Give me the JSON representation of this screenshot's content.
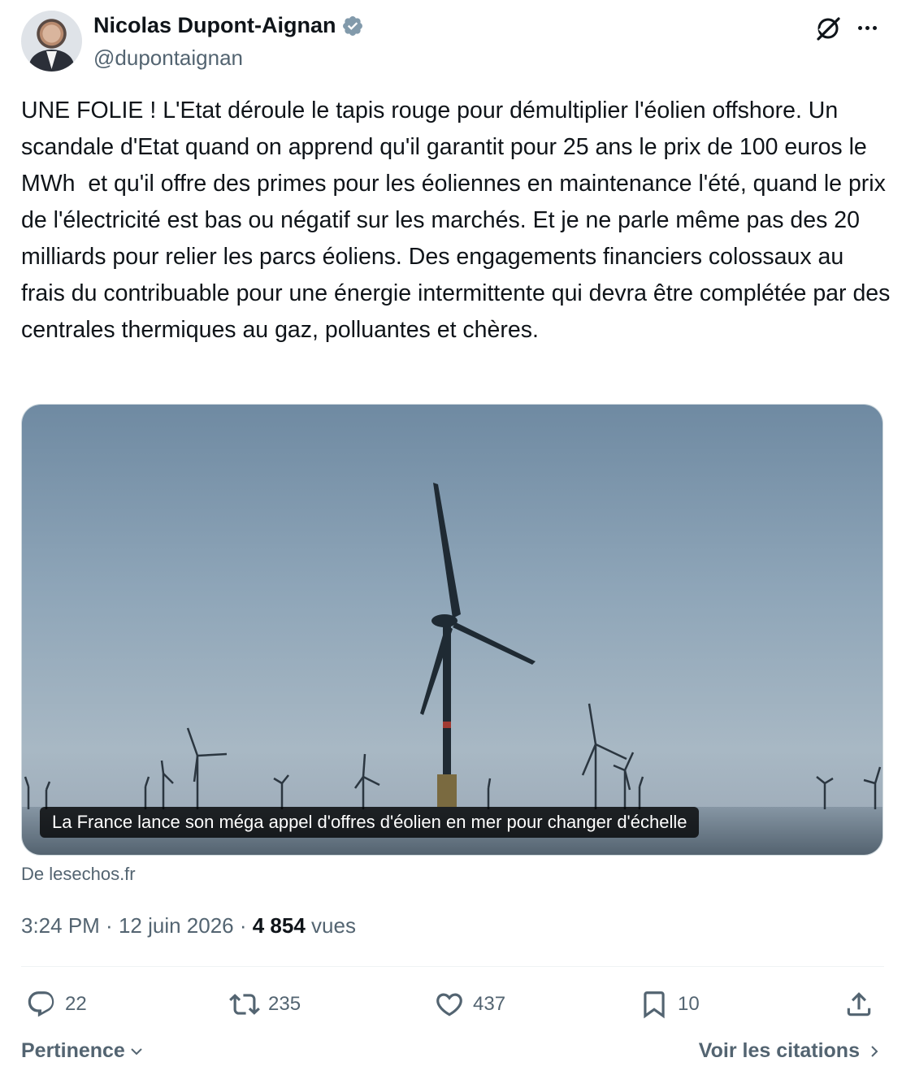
{
  "author": {
    "name": "Nicolas Dupont-Aignan",
    "handle": "@dupontaignan",
    "verified": true
  },
  "tweet": {
    "text": "UNE FOLIE ! L'Etat déroule le tapis rouge pour démultiplier l'éolien offshore. Un scandale d'Etat quand on apprend qu'il garantit pour 25 ans le prix de 100 euros le MWh  et qu'il offre des primes pour les éoliennes en maintenance l'été, quand le prix de l'électricité est bas ou négatif sur les marchés. Et je ne parle même pas des 20 milliards pour relier les parcs éoliens. Des engagements financiers colossaux au frais du contribuable pour une énergie intermittente qui devra être complétée par des centrales thermiques au gaz, polluantes et chères."
  },
  "link_card": {
    "title": "La France lance son méga appel d'offres d'éolien en mer pour changer d'échelle",
    "source": "De lesechos.fr",
    "image_icon": "offshore-wind-turbines-photo"
  },
  "meta": {
    "time": "3:24 PM",
    "separator": " · ",
    "date": "12 juin 2026",
    "views_count": "4 854",
    "views_label": "vues"
  },
  "actions": {
    "replies": "22",
    "reposts": "235",
    "likes": "437",
    "bookmarks": "10"
  },
  "footer": {
    "sort_label": "Pertinence",
    "quotes_link": "Voir les citations"
  },
  "colors": {
    "text_primary": "#0f1419",
    "text_secondary": "#536471",
    "verified_badge": "#829aab",
    "border": "#cfd9de"
  }
}
